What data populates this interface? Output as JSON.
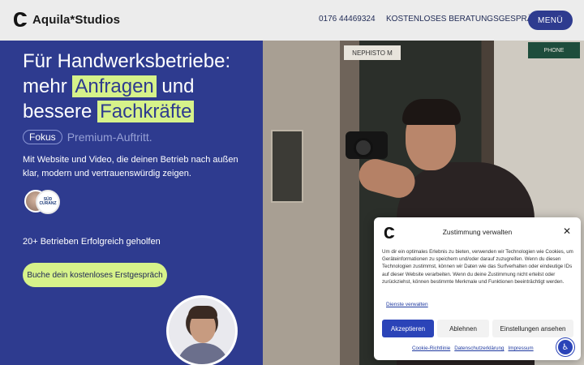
{
  "header": {
    "logo_text": "Aquila*Studios",
    "phone": "0176 44469324",
    "cta_link": "KOSTENLOSES BERATUNGSGESPRÄCH",
    "menu_label": "MENÜ"
  },
  "hero": {
    "headline_part1": "Für Handwerksbetriebe: mehr ",
    "highlight1": "Anfragen",
    "headline_part2": " und bessere ",
    "highlight2": "Fachkräfte",
    "pill_label": "Fokus",
    "rotating_text": "Premium-Auftritt.",
    "subtext": "Mit Website und Video, die deinen Betrieb nach außen klar, modern und vertrauenswürdig zeigen.",
    "badge_text_1": "SÜD",
    "badge_text_2": "CURANZ",
    "helped_text": "20+ Betrieben Erfolgreich geholfen",
    "cta_button": "Buche dein kostenloses Erstgespräch"
  },
  "photo": {
    "sign_left": "NEPHISTO M",
    "sign_right": "PHONE"
  },
  "cookie_modal": {
    "title": "Zustimmung verwalten",
    "close_icon": "close-icon",
    "body": "Um dir ein optimales Erlebnis zu bieten, verwenden wir Technologien wie Cookies, um Geräteinformationen zu speichern und/oder darauf zuzugreifen. Wenn du diesen Technologien zustimmst, können wir Daten wie das Surfverhalten oder eindeutige IDs auf dieser Website verarbeiten. Wenn du deine Zustimmung nicht erteilst oder zurückziehst, können bestimmte Merkmale und Funktionen beeinträchtigt werden.",
    "services_link": "Dienste verwalten",
    "accept_button": "Akzeptieren",
    "reject_button": "Ablehnen",
    "settings_button": "Einstellungen ansehen",
    "footer_links": [
      "Cookie-Richtlinie",
      "Datenschutzerklärung",
      "Impressum"
    ],
    "accessibility_icon": "accessibility-icon"
  },
  "colors": {
    "brand_blue": "#2e3b8f",
    "highlight_lime": "#d6f28a",
    "accept_blue": "#2b44b8"
  }
}
